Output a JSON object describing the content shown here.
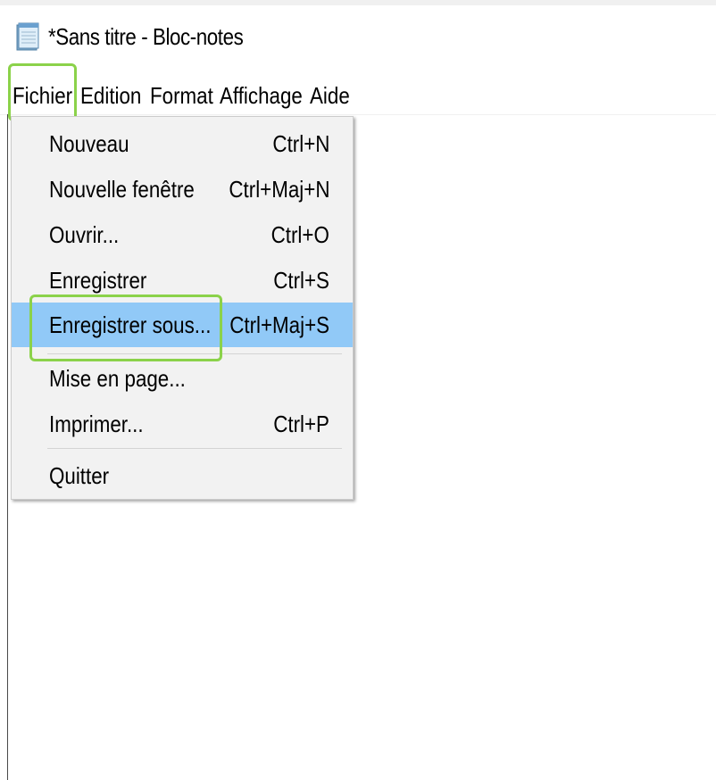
{
  "window": {
    "title": "*Sans titre - Bloc-notes",
    "icon": "notepad-icon"
  },
  "menu_bar": {
    "items": [
      {
        "label": "Fichier",
        "active": true
      },
      {
        "label": "Edition"
      },
      {
        "label": "Format"
      },
      {
        "label": "Affichage"
      },
      {
        "label": "Aide"
      }
    ]
  },
  "file_menu": {
    "items": [
      {
        "label": "Nouveau",
        "shortcut": "Ctrl+N"
      },
      {
        "label": "Nouvelle fenêtre",
        "shortcut": "Ctrl+Maj+N"
      },
      {
        "label": "Ouvrir...",
        "shortcut": "Ctrl+O"
      },
      {
        "label": "Enregistrer",
        "shortcut": "Ctrl+S"
      },
      {
        "label": "Enregistrer sous...",
        "shortcut": "Ctrl+Maj+S",
        "selected": true
      },
      {
        "label": "Mise en page...",
        "shortcut": ""
      },
      {
        "label": "Imprimer...",
        "shortcut": "Ctrl+P"
      },
      {
        "label": "Quitter",
        "shortcut": ""
      }
    ]
  },
  "colors": {
    "highlight_outline": "#8bd24a",
    "selected_item": "#91c9f7",
    "active_menu": "#cce4f7",
    "menu_background": "#f2f2f2"
  }
}
